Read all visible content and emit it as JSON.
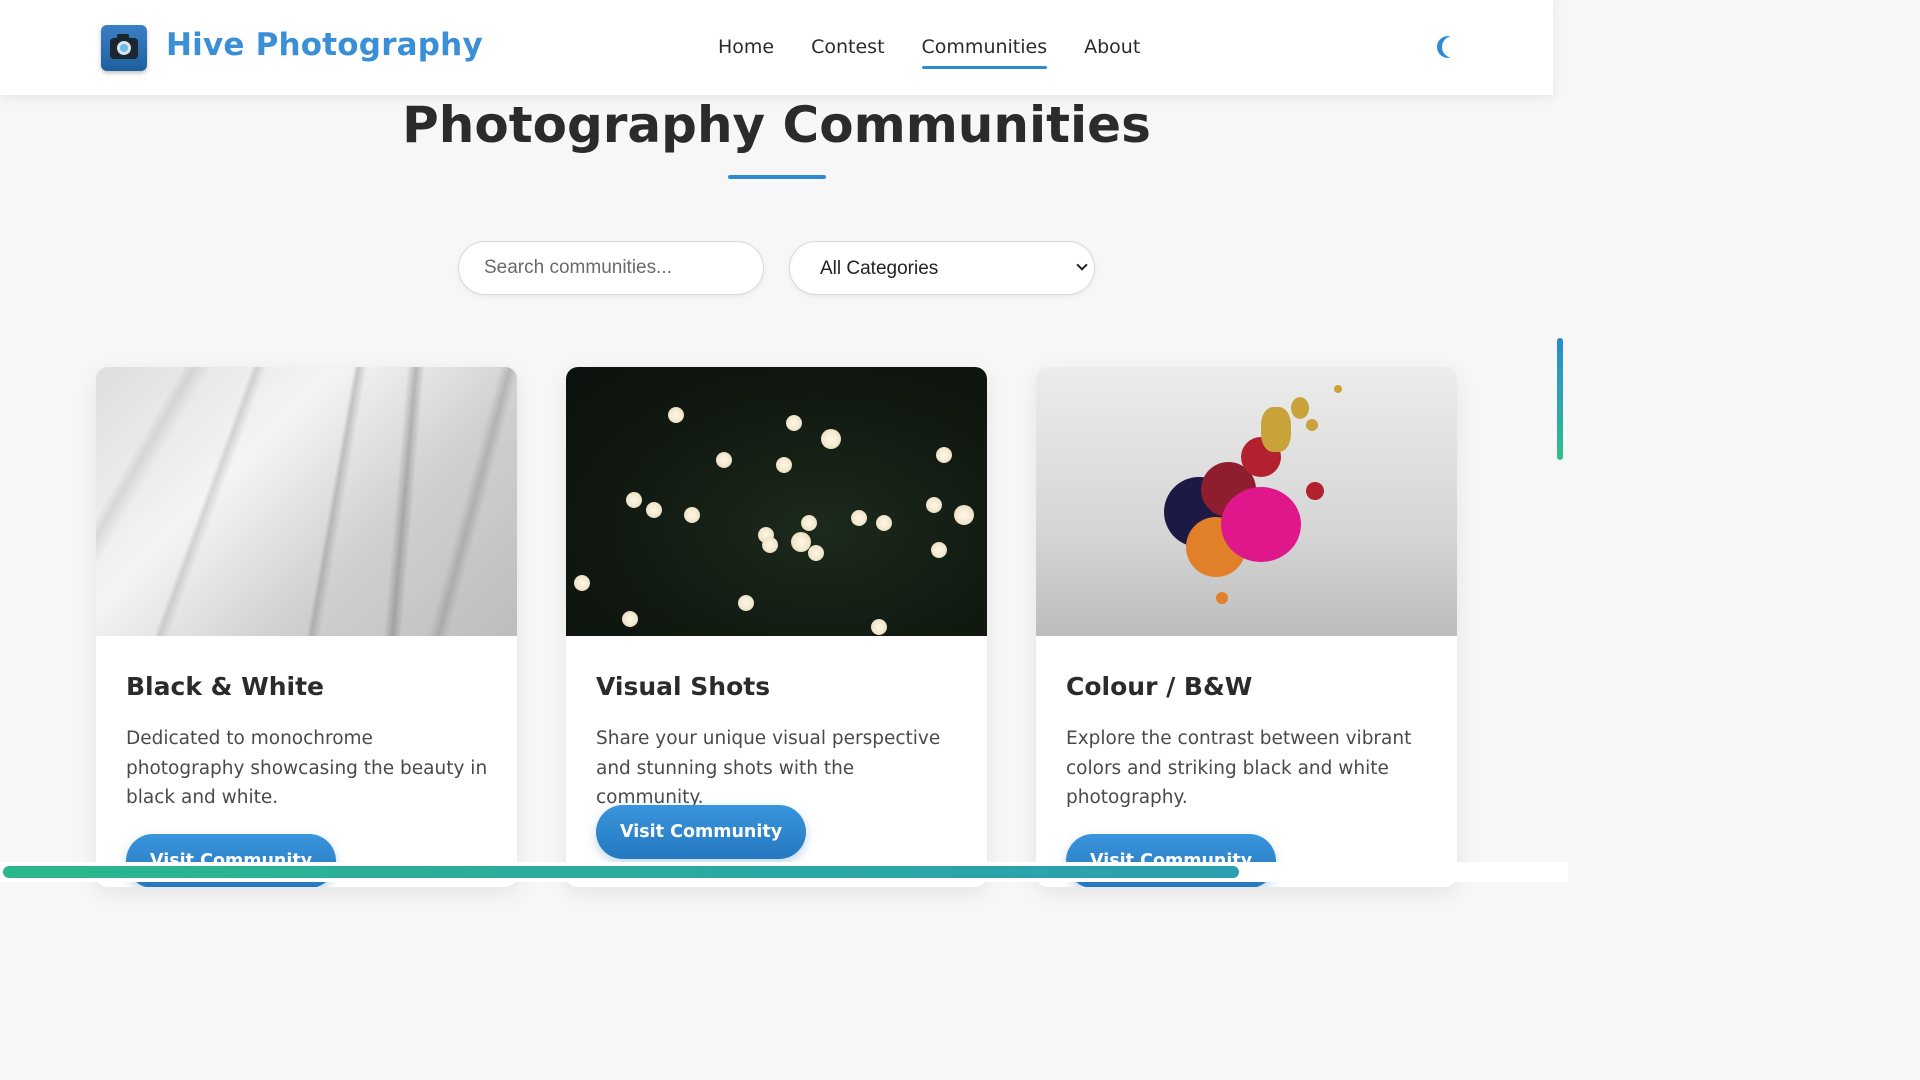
{
  "header": {
    "brand": "Hive Photography",
    "nav": [
      {
        "label": "Home",
        "active": false
      },
      {
        "label": "Contest",
        "active": false
      },
      {
        "label": "Communities",
        "active": true
      },
      {
        "label": "About",
        "active": false
      }
    ],
    "theme_toggle_icon": "moon-icon",
    "logo_icon": "camera-icon"
  },
  "main": {
    "title": "Photography Communities",
    "search_placeholder": "Search communities...",
    "category_select": {
      "selected": "All Categories"
    }
  },
  "cards": [
    {
      "title": "Black & White",
      "description": "Dedicated to monochrome photography showcasing the beauty in black and white.",
      "button": "Visit Community"
    },
    {
      "title": "Visual Shots",
      "description": "Share your unique visual perspective and stunning shots with the community.",
      "button": "Visit Community"
    },
    {
      "title": "Colour / B&W",
      "description": "Explore the contrast between vibrant colors and striking black and white photography.",
      "button": "Visit Community"
    }
  ],
  "colors": {
    "accent": "#2d8ad3",
    "brand_text": "#3a8fd6",
    "progress": "#2bb78c"
  }
}
